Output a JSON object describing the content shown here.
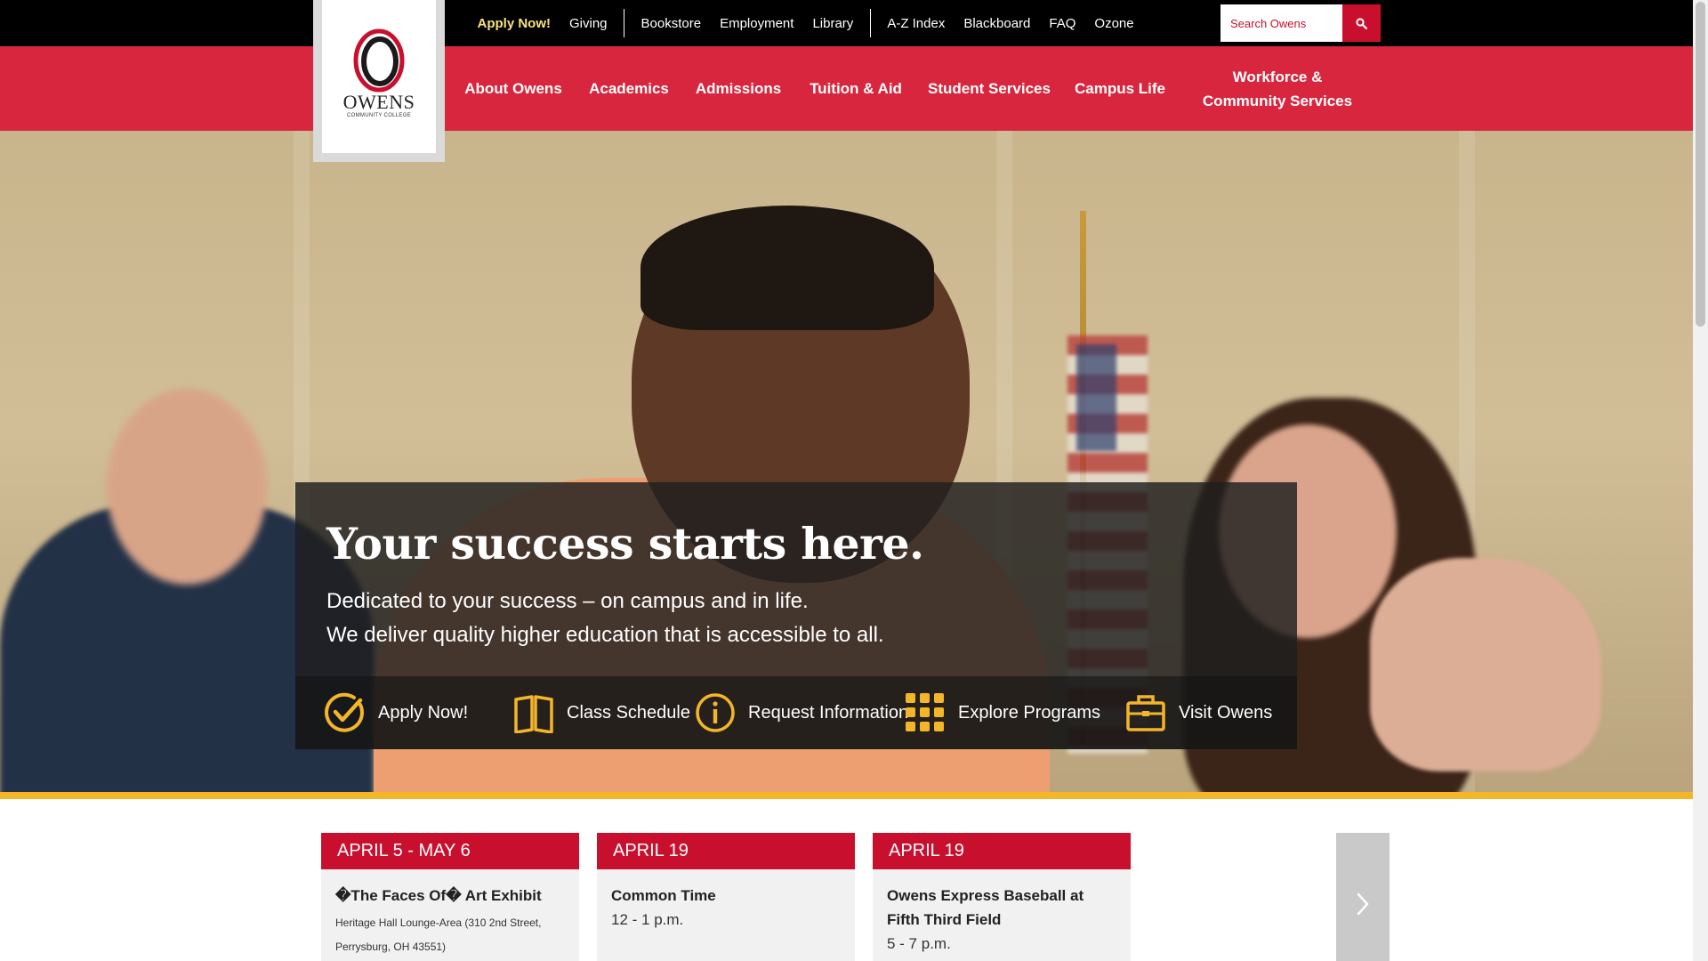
{
  "utility_nav": {
    "apply": "Apply Now!",
    "giving": "Giving",
    "bookstore": "Bookstore",
    "employment": "Employment",
    "library": "Library",
    "az_index": "A-Z Index",
    "blackboard": "Blackboard",
    "faq": "FAQ",
    "ozone": "Ozone"
  },
  "search": {
    "placeholder": "Search Owens",
    "icon": "search-icon"
  },
  "logo": {
    "wordmark": "OWENS",
    "subtitle": "COMMUNITY COLLEGE"
  },
  "main_nav": {
    "about": "About Owens",
    "academics": "Academics",
    "admissions": "Admissions",
    "tuition": "Tuition & Aid",
    "student_services": "Student Services",
    "campus_life": "Campus Life",
    "workforce_line1": "Workforce &",
    "workforce_line2": "Community Services"
  },
  "hero": {
    "title": "Your success starts here.",
    "line1": "Dedicated to your success – on campus and in life.",
    "line2": "We deliver quality higher education that is accessible to all."
  },
  "quick_links": {
    "apply": {
      "label": "Apply Now!",
      "icon": "checkmark-circle-icon"
    },
    "schedule": {
      "label": "Class Schedule",
      "icon": "open-book-icon"
    },
    "info": {
      "label": "Request Information",
      "icon": "info-circle-icon"
    },
    "programs": {
      "label": "Explore Programs",
      "icon": "grid-icon"
    },
    "visit": {
      "label": "Visit Owens",
      "icon": "briefcase-icon"
    }
  },
  "events": [
    {
      "date": "APRIL 5 - MAY 6",
      "title": "�The Faces Of� Art Exhibit",
      "location": "Heritage Hall Lounge-Area (310 2nd Street, Perrysburg, OH 43551)"
    },
    {
      "date": "APRIL 19",
      "title": "Common Time",
      "time": "12 - 1 p.m."
    },
    {
      "date": "APRIL 19",
      "title": "Owens Express Baseball at Fifth Third Field",
      "time": "5 - 7 p.m."
    }
  ],
  "colors": {
    "brand_red": "#d7263d",
    "dark_red": "#c8102e",
    "gold": "#f4b629",
    "apply_yellow": "#f9e27a",
    "topbar": "#000000"
  }
}
